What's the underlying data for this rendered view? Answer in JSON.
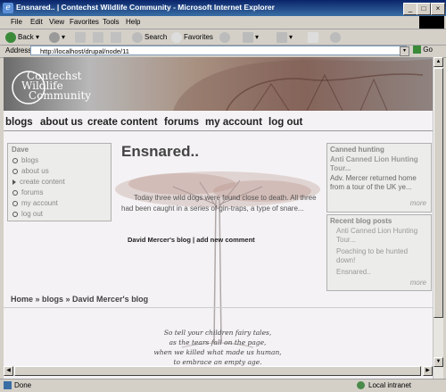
{
  "window": {
    "title": "Ensnared.. | Contechst Wildlife Community - Microsoft Internet Explorer",
    "icon": "ie-icon"
  },
  "menu": [
    "File",
    "Edit",
    "View",
    "Favorites",
    "Tools",
    "Help"
  ],
  "toolbar": {
    "back": "Back",
    "search": "Search",
    "favorites": "Favorites",
    "go": "Go",
    "address_label": "Address"
  },
  "address": "http://localhost/drupal/node/11",
  "status": {
    "left": "Done",
    "zone": "Local intranet"
  },
  "site": {
    "logo_lines": [
      "ontechst",
      "ildlife",
      "ommunity"
    ],
    "nav": [
      "blogs",
      "about us",
      "create content",
      "forums",
      "my account",
      "log out"
    ],
    "user_block": {
      "title": "Dave",
      "items": [
        "blogs",
        "about us",
        "create content",
        "forums",
        "my account",
        "log out"
      ]
    },
    "article": {
      "title": "Ensnared..",
      "body": "Today three wild dogs were found close to death. All three had been caught in a series of gin-traps, a type of snare...",
      "meta": "David Mercer's blog | add new comment"
    },
    "canned": {
      "title": "Canned hunting",
      "item_title": "Anti Canned Lion Hunting Tour...",
      "item_text": "Adv. Mercer returned home from a tour of the UK ye...",
      "more": "more"
    },
    "recent": {
      "title": "Recent blog posts",
      "items": [
        "Anti Canned Lion Hunting Tour...",
        "Poaching to be hunted down!",
        "Ensnared.."
      ],
      "more": "more"
    },
    "breadcrumb": "Home » blogs » David Mercer's blog",
    "poem": [
      "So tell your children fairy tales,",
      "as the tears fall on the page,",
      "when we killed what made us human,",
      "to embrace an empty age."
    ]
  },
  "colors": {
    "titlebar": "#0a246a",
    "page_bg": "#f4f2f4",
    "heading": "#444444"
  }
}
